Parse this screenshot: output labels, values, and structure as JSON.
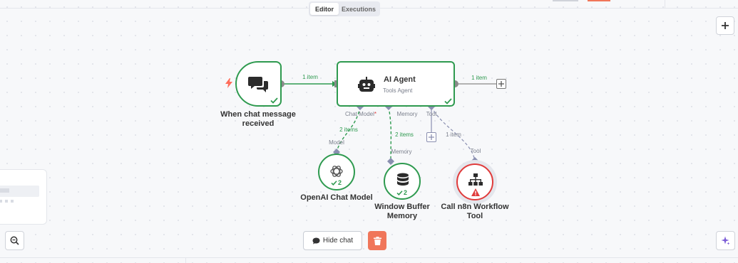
{
  "header": {
    "tabs": [
      {
        "label": "Editor",
        "active": true
      },
      {
        "label": "Executions",
        "active": false
      }
    ]
  },
  "nodes": {
    "trigger": {
      "label_line1": "When chat message",
      "label_line2": "received",
      "icon": "chat-bubbles-icon",
      "status": "success"
    },
    "agent": {
      "title": "AI Agent",
      "subtitle": "Tools Agent",
      "icon": "robot-icon",
      "status": "success"
    },
    "model": {
      "label": "OpenAI Chat Model",
      "icon": "openai-icon",
      "badge_count": "2",
      "status": "success"
    },
    "memory": {
      "label_line1": "Window Buffer",
      "label_line2": "Memory",
      "icon": "database-icon",
      "badge_count": "2",
      "status": "success"
    },
    "tool": {
      "label_line1": "Call n8n Workflow",
      "label_line2": "Tool",
      "icon": "network-icon",
      "status": "error"
    }
  },
  "connections": {
    "trigger_to_agent": "1 item",
    "agent_output": "1 item",
    "agent_to_model": "2 items",
    "agent_to_memory": "2 items",
    "agent_to_tool": "1 item"
  },
  "ports": {
    "chat_model": "Chat Model",
    "chat_model_required": "*",
    "memory": "Memory",
    "tool": "Tool",
    "model_in": "Model",
    "memory_in": "Memory",
    "tool_in": "Tool"
  },
  "footer": {
    "hide_chat_label": "Hide chat"
  },
  "colors": {
    "success": "#2e9a4f",
    "error": "#e03c3c",
    "trigger_accent": "#ff6d5a",
    "delete_button": "#f0765a",
    "port": "#8a8fb0"
  }
}
